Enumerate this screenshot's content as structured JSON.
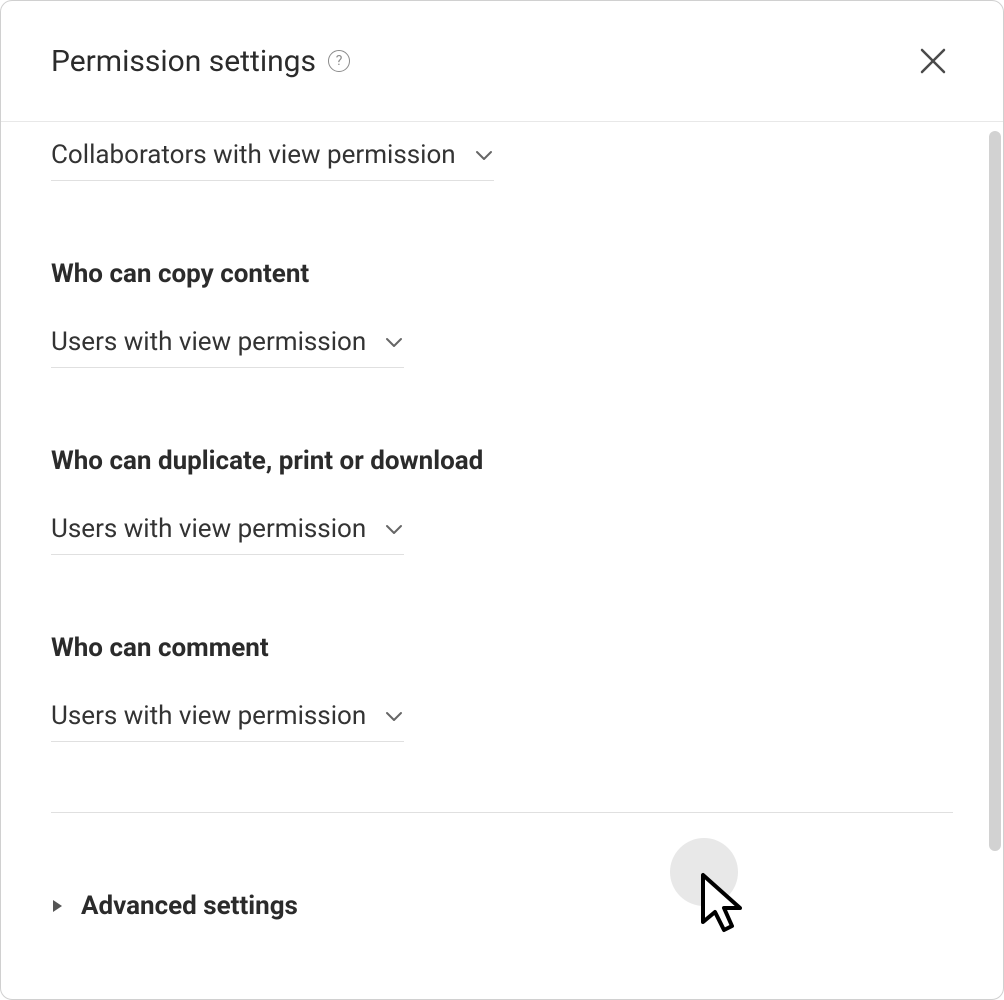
{
  "header": {
    "title": "Permission settings"
  },
  "sections": {
    "top_select": {
      "value": "Collaborators with view permission"
    },
    "copy": {
      "label": "Who can copy content",
      "value": "Users with view permission"
    },
    "duplicate": {
      "label": "Who can duplicate, print or download",
      "value": "Users with view permission"
    },
    "comment": {
      "label": "Who can comment",
      "value": "Users with view permission"
    }
  },
  "advanced": {
    "label": "Advanced settings"
  }
}
